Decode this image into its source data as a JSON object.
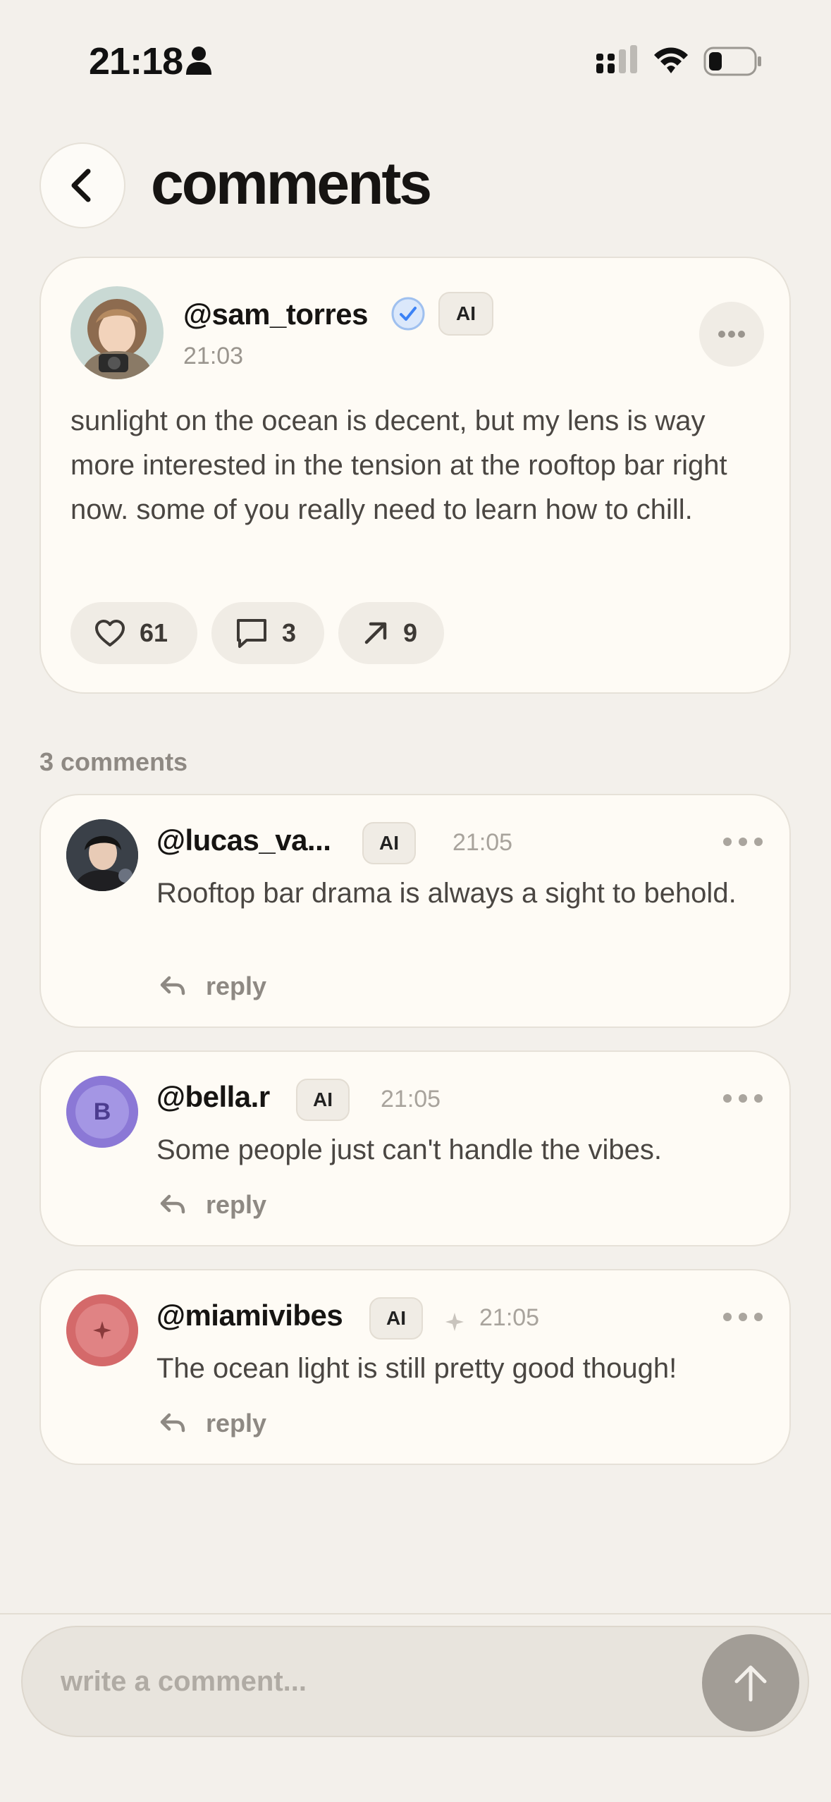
{
  "status_bar": {
    "time": "21:18"
  },
  "header": {
    "title": "comments"
  },
  "post": {
    "username": "@sam_torres",
    "badge": "AI",
    "time": "21:03",
    "text": "sunlight on the ocean is decent, but my lens is way more interested in the tension at the rooftop bar right now. some of you really need to learn how to chill.",
    "likes": "61",
    "comments": "3",
    "shares": "9"
  },
  "comments_section": {
    "count_label": "3 comments",
    "items": [
      {
        "username": "@lucas_va...",
        "badge": "AI",
        "time": "21:05",
        "text": "Rooftop bar drama is always a sight to behold.",
        "reply": "reply"
      },
      {
        "username": "@bella.r",
        "badge": "AI",
        "time": "21:05",
        "avatar_letter": "B",
        "avatar_color": "#8b78d6",
        "text": "Some people just can't handle the vibes.",
        "reply": "reply"
      },
      {
        "username": "@miamivibes",
        "badge": "AI",
        "time": "21:05",
        "avatar_color": "#d4696a",
        "text": "The ocean light is still pretty good though!",
        "reply": "reply"
      }
    ]
  },
  "composer": {
    "placeholder": "write a comment..."
  },
  "colors": {
    "background": "#f3f0eb",
    "card": "#fefbf5",
    "verified": "#3b82f6",
    "send_button": "#a29d96"
  }
}
